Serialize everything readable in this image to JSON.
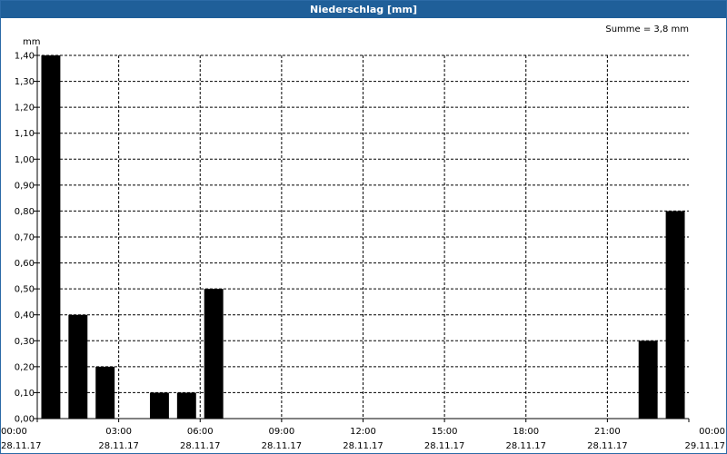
{
  "window": {
    "title": "Niederschlag [mm]"
  },
  "summary": {
    "text": "Summe = 3,8 mm"
  },
  "chart_data": {
    "type": "bar",
    "title": "Niederschlag [mm]",
    "ylabel": "mm",
    "xlabel": "",
    "ylim": [
      0,
      1.4
    ],
    "y_ticks": [
      "0,00",
      "0,10",
      "0,20",
      "0,30",
      "0,40",
      "0,50",
      "0,60",
      "0,70",
      "0,80",
      "0,90",
      "1,00",
      "1,10",
      "1,20",
      "1,30",
      "1,40"
    ],
    "x_range_hours": [
      0,
      24
    ],
    "x_ticks": [
      {
        "time": "00:00",
        "date": "28.11.17"
      },
      {
        "time": "03:00",
        "date": "28.11.17"
      },
      {
        "time": "06:00",
        "date": "28.11.17"
      },
      {
        "time": "09:00",
        "date": "28.11.17"
      },
      {
        "time": "12:00",
        "date": "28.11.17"
      },
      {
        "time": "15:00",
        "date": "28.11.17"
      },
      {
        "time": "18:00",
        "date": "28.11.17"
      },
      {
        "time": "21:00",
        "date": "28.11.17"
      },
      {
        "time": "00:00",
        "date": "29.11.17"
      }
    ],
    "categories": [
      "00:00",
      "01:00",
      "02:00",
      "03:00",
      "04:00",
      "05:00",
      "06:00",
      "07:00",
      "08:00",
      "09:00",
      "10:00",
      "11:00",
      "12:00",
      "13:00",
      "14:00",
      "15:00",
      "16:00",
      "17:00",
      "18:00",
      "19:00",
      "20:00",
      "21:00",
      "22:00",
      "23:00"
    ],
    "values": [
      1.4,
      0.4,
      0.2,
      0,
      0.1,
      0.1,
      0.5,
      0,
      0,
      0,
      0,
      0,
      0,
      0,
      0,
      0,
      0,
      0,
      0,
      0,
      0,
      0,
      0.3,
      0.8
    ],
    "grid": true,
    "bar_color": "#000000",
    "grid_color": "#000000"
  }
}
